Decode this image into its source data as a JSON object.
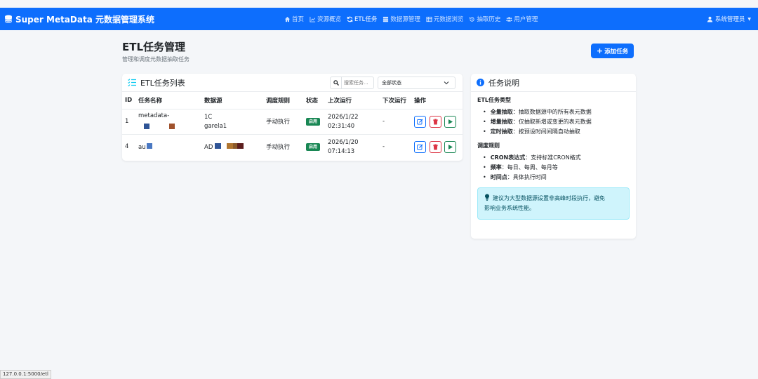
{
  "app": {
    "brand": "Super MetaData 元数据管理系统"
  },
  "nav": [
    {
      "label": "首页",
      "icon": "home-icon"
    },
    {
      "label": "资源概览",
      "icon": "chart-icon"
    },
    {
      "label": "ETL任务",
      "icon": "sync-icon"
    },
    {
      "label": "数据源管理",
      "icon": "database-icon"
    },
    {
      "label": "元数据浏览",
      "icon": "table-icon"
    },
    {
      "label": "抽取历史",
      "icon": "history-icon"
    },
    {
      "label": "用户管理",
      "icon": "users-icon"
    }
  ],
  "user": {
    "name": "系统管理员"
  },
  "page": {
    "title": "ETL任务管理",
    "subtitle": "管理和调度元数据抽取任务",
    "add_button": "添加任务"
  },
  "list": {
    "title": "ETL任务列表",
    "search_placeholder": "搜索任务...",
    "status_filter": "全部状态",
    "columns": [
      "ID",
      "任务名称",
      "数据源",
      "调度规则",
      "状态",
      "上次运行",
      "下次运行",
      "操作"
    ],
    "rows": [
      {
        "id": "1",
        "name": "metadata-",
        "source_line1": "1C",
        "source_line2": "garela1",
        "schedule": "手动执行",
        "status": "启用",
        "last_run_date": "2026/1/22",
        "last_run_time": "02:31:40",
        "next_run": "-"
      },
      {
        "id": "4",
        "name": "au",
        "source_line1": "AD",
        "source_line2": "",
        "schedule": "手动执行",
        "status": "启用",
        "last_run_date": "2026/1/20",
        "last_run_time": "07:14:13",
        "next_run": "-"
      }
    ]
  },
  "info": {
    "title": "任务说明",
    "section1_title": "ETL任务类型",
    "section1_items": [
      {
        "key": "全量抽取",
        "text": "：抽取数据源中的所有表元数据"
      },
      {
        "key": "增量抽取",
        "text": "：仅抽取新增或变更的表元数据"
      },
      {
        "key": "定时抽取",
        "text": "：按预设时间间隔自动抽取"
      }
    ],
    "section2_title": "调度规则",
    "section2_items": [
      {
        "key": "CRON表达式",
        "text": "：支持标准CRON格式"
      },
      {
        "key": "频率",
        "text": "：每日、每周、每月等"
      },
      {
        "key": "时间点",
        "text": "：具体执行时间"
      }
    ],
    "tip_line1": "建议为大型数据源设置非高峰时段执行，避免",
    "tip_line2": "影响业务系统性能。"
  },
  "statusbar": {
    "url": "127.0.0.1:5000/etl"
  },
  "colors": {
    "primary": "#0d6efd",
    "success": "#198754",
    "danger": "#dc3545",
    "info_bg": "#cff4fc"
  }
}
